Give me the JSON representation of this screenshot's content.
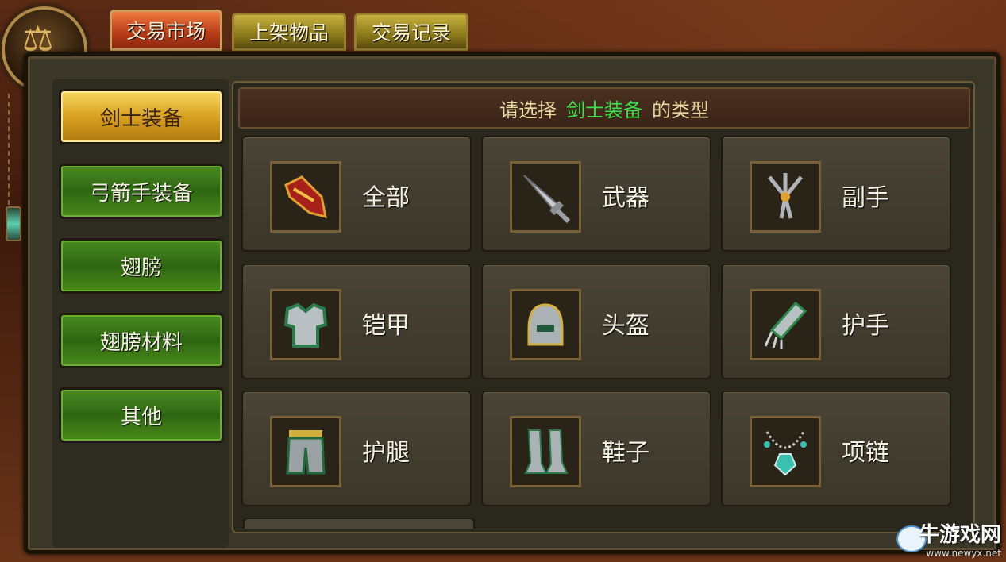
{
  "emblem": {
    "label": "市场"
  },
  "tabs": [
    {
      "label": "交易市场",
      "active": true
    },
    {
      "label": "上架物品",
      "active": false
    },
    {
      "label": "交易记录",
      "active": false
    }
  ],
  "categories": [
    {
      "label": "剑士装备",
      "selected": true
    },
    {
      "label": "弓箭手装备",
      "selected": false
    },
    {
      "label": "翅膀",
      "selected": false
    },
    {
      "label": "翅膀材料",
      "selected": false
    },
    {
      "label": "其他",
      "selected": false
    }
  ],
  "header": {
    "prefix": "请选择",
    "highlight": "剑士装备",
    "suffix": "的类型"
  },
  "items": [
    {
      "label": "全部",
      "icon": "gloves-icon"
    },
    {
      "label": "武器",
      "icon": "sword-icon"
    },
    {
      "label": "副手",
      "icon": "trident-icon"
    },
    {
      "label": "铠甲",
      "icon": "armor-icon"
    },
    {
      "label": "头盔",
      "icon": "helmet-icon"
    },
    {
      "label": "护手",
      "icon": "gauntlet-icon"
    },
    {
      "label": "护腿",
      "icon": "leggings-icon"
    },
    {
      "label": "鞋子",
      "icon": "boots-icon"
    },
    {
      "label": "项链",
      "icon": "necklace-icon"
    }
  ],
  "watermark": {
    "title": "牛游戏网",
    "url": "www.newyx.net"
  },
  "colors": {
    "highlight": "#3ae04a",
    "tab_active": "#b83a18",
    "category_green": "#2e6612",
    "category_gold": "#d8a020"
  }
}
